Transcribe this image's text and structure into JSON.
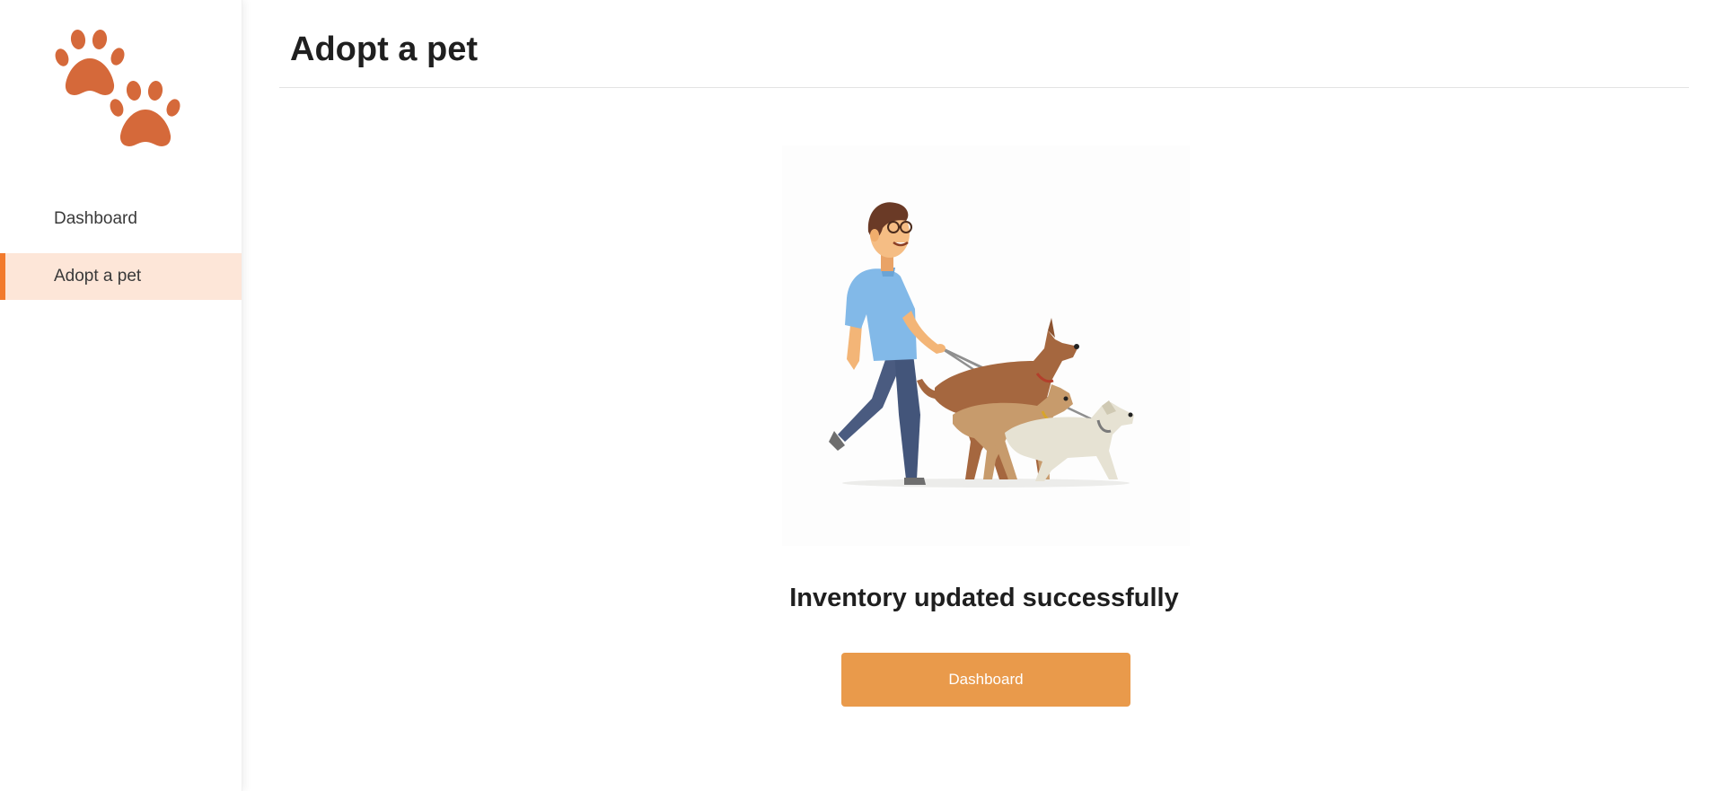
{
  "app": {
    "logo_icon": "paw-prints-icon",
    "brand_color": "#d5693a",
    "accent_color": "#f27a2c",
    "active_bg_color": "#fde6d8"
  },
  "sidebar": {
    "items": [
      {
        "label": "Dashboard",
        "active": false
      },
      {
        "label": "Adopt a pet",
        "active": true
      }
    ]
  },
  "header": {
    "title": "Adopt a pet"
  },
  "main": {
    "illustration": "man-walking-dogs-illustration",
    "status_message": "Inventory updated successfully",
    "dashboard_button_label": "Dashboard",
    "button_color": "#e99a4b"
  }
}
